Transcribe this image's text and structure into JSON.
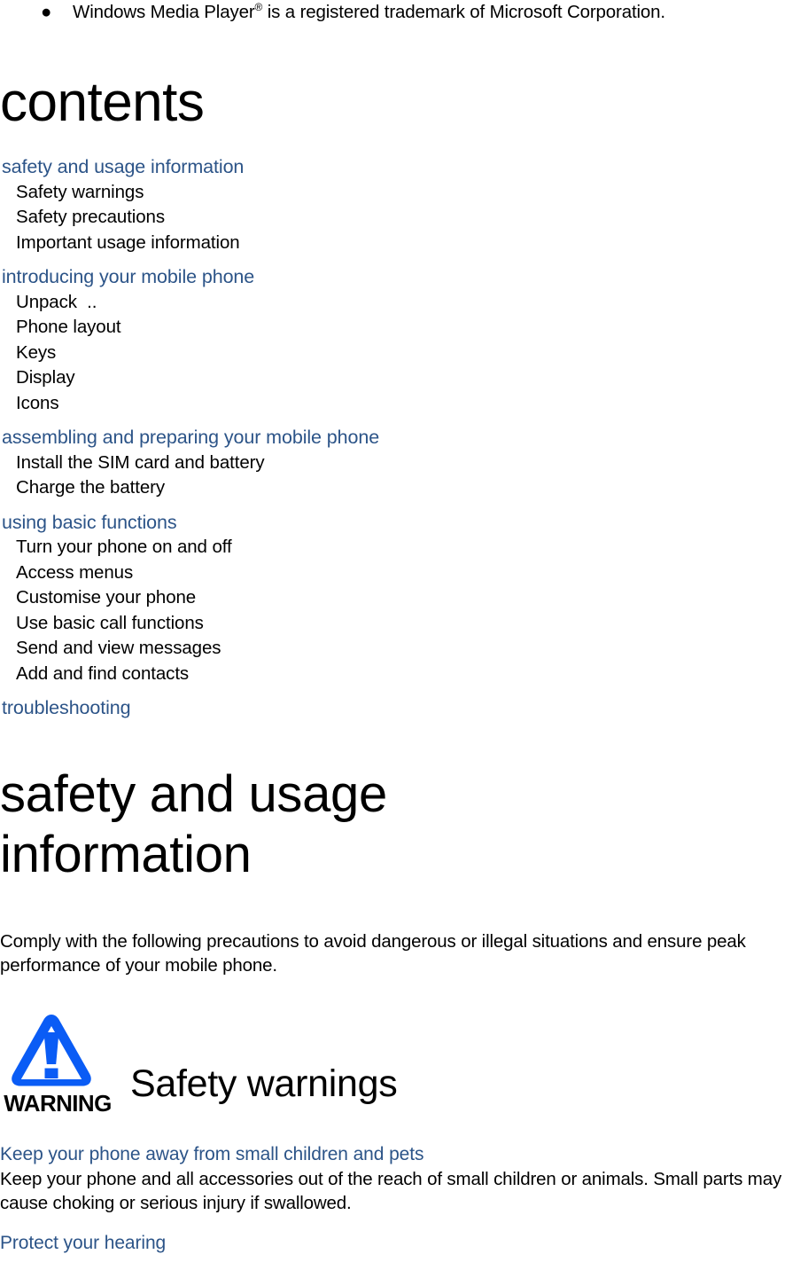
{
  "trademarks": [
    {
      "bullet_glyph": "●",
      "text_before_sup": "Windows Media Player",
      "superscript": "®",
      "text_after_sup": " is a registered trademark of Microsoft Corporation."
    }
  ],
  "contents": {
    "title": "contents",
    "sections": [
      {
        "heading": "safety and usage information",
        "items": [
          "Safety warnings",
          "Safety precautions",
          "Important usage information"
        ]
      },
      {
        "heading": "introducing your mobile phone",
        "items": [
          "Unpack  ..",
          "Phone layout",
          "Keys",
          "Display",
          "Icons"
        ]
      },
      {
        "heading": "assembling and preparing your mobile phone",
        "items": [
          "Install the SIM card and battery",
          "Charge the battery"
        ]
      },
      {
        "heading": "using basic functions",
        "items": [
          "Turn your phone on and off",
          "Access menus",
          "Customise your phone",
          "Use basic call functions",
          "Send and view messages",
          "Add and find contacts"
        ]
      },
      {
        "heading": "troubleshooting",
        "items": []
      }
    ]
  },
  "safety_chapter": {
    "title": "safety and usage information",
    "intro": "Comply with the following precautions to avoid dangerous or illegal situations and ensure peak performance of your mobile phone.",
    "warning_badge": {
      "label": "WARNING",
      "icon": "warning-triangle-icon",
      "color": "#0a5cf5"
    },
    "warning_heading": "Safety warnings",
    "sections": [
      {
        "heading": "Keep your phone away from small children and pets",
        "text": "Keep your phone and all accessories out of the reach of small children or animals. Small parts may cause choking or serious injury if swallowed."
      },
      {
        "heading": "Protect your hearing",
        "text": ""
      }
    ]
  },
  "colors": {
    "heading_blue": "#2c5488",
    "body_black": "#000000",
    "warning_blue": "#0a5cf5",
    "page_background": "#ffffff"
  }
}
